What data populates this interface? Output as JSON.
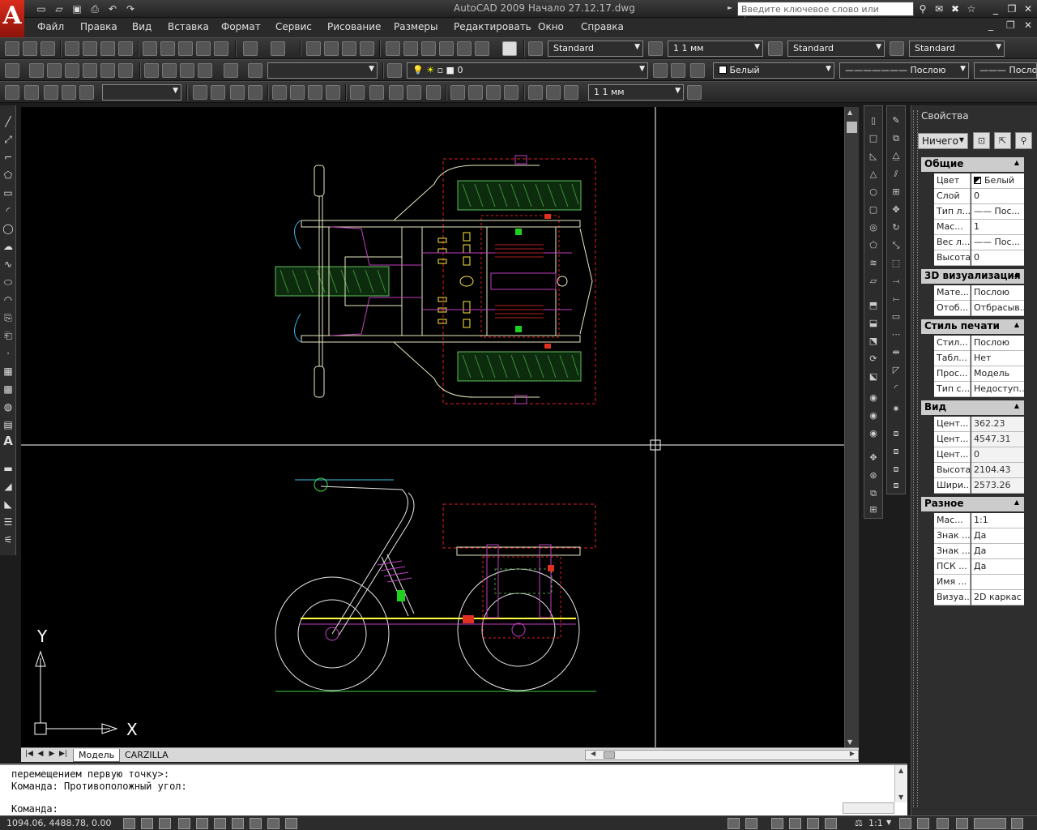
{
  "window": {
    "title": "AutoCAD 2009 Начало 27.12.17.dwg",
    "search_placeholder": "Введите ключевое слово или фразу",
    "logo_letter": "A"
  },
  "menu": [
    "Файл",
    "Правка",
    "Вид",
    "Вставка",
    "Формат",
    "Сервис",
    "Рисование",
    "Размеры",
    "Редактировать",
    "Окно",
    "Справка"
  ],
  "toolbar1": {
    "text_style": "Standard",
    "dim_size": "1 1 мм",
    "dim_style": "Standard",
    "table_style": "Standard"
  },
  "toolbar2": {
    "layer_value": "0",
    "color": "Белый",
    "linetype": "Послою",
    "lineweight": "Посло"
  },
  "toolbar3": {
    "size": "1 1 мм"
  },
  "ucs": {
    "x_label": "X",
    "y_label": "Y"
  },
  "tabs": {
    "model": "Модель",
    "layout": "CARZILLA"
  },
  "command_line": {
    "line1": "перемещением первую точку>:",
    "line2": "Команда: Противоположный угол:",
    "prompt": "Команда:"
  },
  "status": {
    "coords": "1094.06, 4488.78, 0.00",
    "scale": "1:1"
  },
  "properties": {
    "title": "Свойства",
    "selection": "Ничего",
    "sections": [
      {
        "name": "Общие",
        "rows": [
          {
            "k": "Цвет",
            "v": "Белый"
          },
          {
            "k": "Слой",
            "v": "0"
          },
          {
            "k": "Тип л...",
            "v": "—— Пос..."
          },
          {
            "k": "Мас...",
            "v": "1"
          },
          {
            "k": "Вес л...",
            "v": "—— Пос..."
          },
          {
            "k": "Высота",
            "v": "0"
          }
        ]
      },
      {
        "name": "3D визуализация",
        "rows": [
          {
            "k": "Мате...",
            "v": "Послою"
          },
          {
            "k": "Отоб...",
            "v": "Отбрасыв..."
          }
        ]
      },
      {
        "name": "Стиль печати",
        "rows": [
          {
            "k": "Стил...",
            "v": "Послою"
          },
          {
            "k": "Табл...",
            "v": "Нет"
          },
          {
            "k": "Прос...",
            "v": "Модель"
          },
          {
            "k": "Тип с...",
            "v": "Недоступ..."
          }
        ]
      },
      {
        "name": "Вид",
        "rows": [
          {
            "k": "Цент...",
            "v": "362.23"
          },
          {
            "k": "Цент...",
            "v": "4547.31"
          },
          {
            "k": "Цент...",
            "v": "0"
          },
          {
            "k": "Высота",
            "v": "2104.43"
          },
          {
            "k": "Шири...",
            "v": "2573.26"
          }
        ]
      },
      {
        "name": "Разное",
        "rows": [
          {
            "k": "Мас...",
            "v": "1:1"
          },
          {
            "k": "Знак ...",
            "v": "Да"
          },
          {
            "k": "Знак ...",
            "v": "Да"
          },
          {
            "k": "ПСК ...",
            "v": "Да"
          },
          {
            "k": "Имя ...",
            "v": ""
          },
          {
            "k": "Визуа...",
            "v": "2D каркас"
          }
        ]
      }
    ]
  }
}
